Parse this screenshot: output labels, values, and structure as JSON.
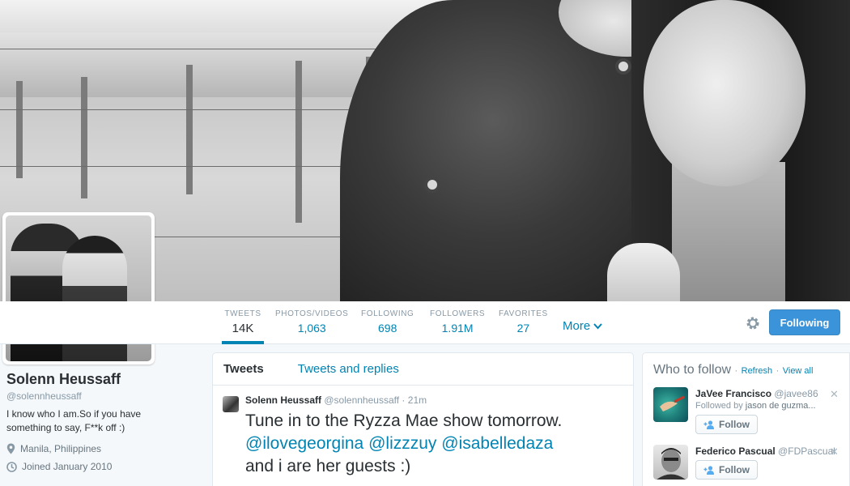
{
  "profile": {
    "name": "Solenn Heussaff",
    "handle": "@solennheussaff",
    "bio": "I know who I am.So if you have something to say, F**k off :)",
    "location": "Manila, Philippines",
    "joined": "Joined January 2010"
  },
  "stats": [
    {
      "label": "TWEETS",
      "value": "14K"
    },
    {
      "label": "PHOTOS/VIDEOS",
      "value": "1,063"
    },
    {
      "label": "FOLLOWING",
      "value": "698"
    },
    {
      "label": "FOLLOWERS",
      "value": "1.91M"
    },
    {
      "label": "FAVORITES",
      "value": "27"
    }
  ],
  "nav": {
    "more_label": "More",
    "following_button": "Following",
    "settings_icon": "gear-icon"
  },
  "timeline": {
    "tabs": [
      "Tweets",
      "Tweets and replies"
    ],
    "tweet": {
      "author": "Solenn Heussaff",
      "handle": "@solennheussaff",
      "separator": "·",
      "time": "21m",
      "text_part1": "Tune in to the Ryzza Mae show tomorrow.",
      "mention1": "@ilovegeorgina",
      "mention2": "@lizzzuy",
      "mention3": "@isabelledaza",
      "text_part2": "and i are her guests :)"
    }
  },
  "who_to_follow": {
    "title": "Who to follow",
    "refresh": "Refresh",
    "view_all": "View all",
    "dot": "·",
    "suggestions": [
      {
        "name": "JaVee Francisco",
        "handle": "@javee86",
        "followed_by_prefix": "Followed by",
        "followed_by": "jason de guzma...",
        "button": "Follow"
      },
      {
        "name": "Federico Pascual",
        "handle": "@FDPascual",
        "button": "Follow"
      }
    ]
  },
  "colors": {
    "link": "#0084b4",
    "follow_button": "#3b94d9",
    "muted": "#8899a6",
    "text": "#292f33"
  }
}
